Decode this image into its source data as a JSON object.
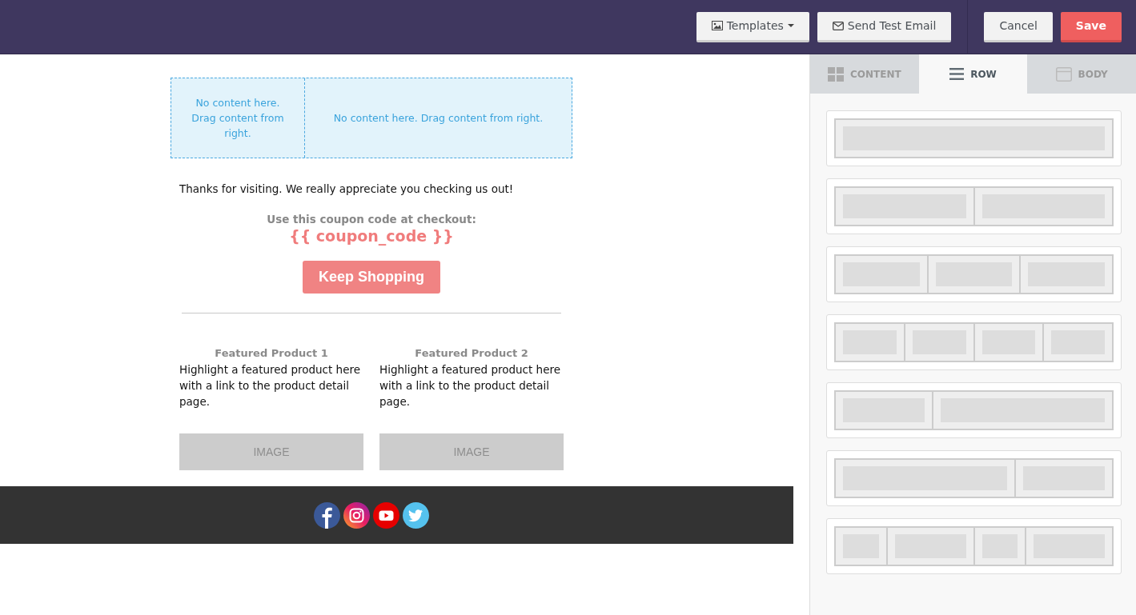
{
  "toolbar": {
    "buttons": [
      {
        "kind": "templates",
        "label": "Templates"
      },
      {
        "kind": "test",
        "label": "Send Test Email"
      },
      {
        "kind": "cancel",
        "label": "Cancel"
      },
      {
        "kind": "save",
        "label": "Save"
      }
    ]
  },
  "email": {
    "empty_columns": [
      {
        "text": "No content here. Drag content from right."
      },
      {
        "text": "No content here. Drag content from right."
      }
    ],
    "message": "Thanks for visiting. We really appreciate you checking us out!",
    "coupon_label": "Use this coupon code at checkout:",
    "coupon_code": "{{ coupon_code }}",
    "cta": "Keep Shopping",
    "products": [
      {
        "title": "Featured Product 1",
        "description": "Highlight a featured product here with a link to the product detail page.",
        "image_label": "IMAGE"
      },
      {
        "title": "Featured Product 2",
        "description": "Highlight a featured product here with a link to the product detail page.",
        "image_label": "IMAGE"
      }
    ],
    "social": [
      {
        "kind": "facebook"
      },
      {
        "kind": "instagram"
      },
      {
        "kind": "youtube"
      },
      {
        "kind": "twitter"
      }
    ]
  },
  "sidebar": {
    "tabs": [
      {
        "kind": "content",
        "label": "CONTENT",
        "selected": false
      },
      {
        "kind": "row",
        "label": "ROW",
        "selected": true
      },
      {
        "kind": "body",
        "label": "BODY",
        "selected": false
      }
    ],
    "row_layouts": [
      {
        "kind": "one"
      },
      {
        "kind": "halves"
      },
      {
        "kind": "thirds"
      },
      {
        "kind": "quarters"
      },
      {
        "kind": "third-left"
      },
      {
        "kind": "third-right"
      },
      {
        "kind": "mixed"
      }
    ]
  }
}
